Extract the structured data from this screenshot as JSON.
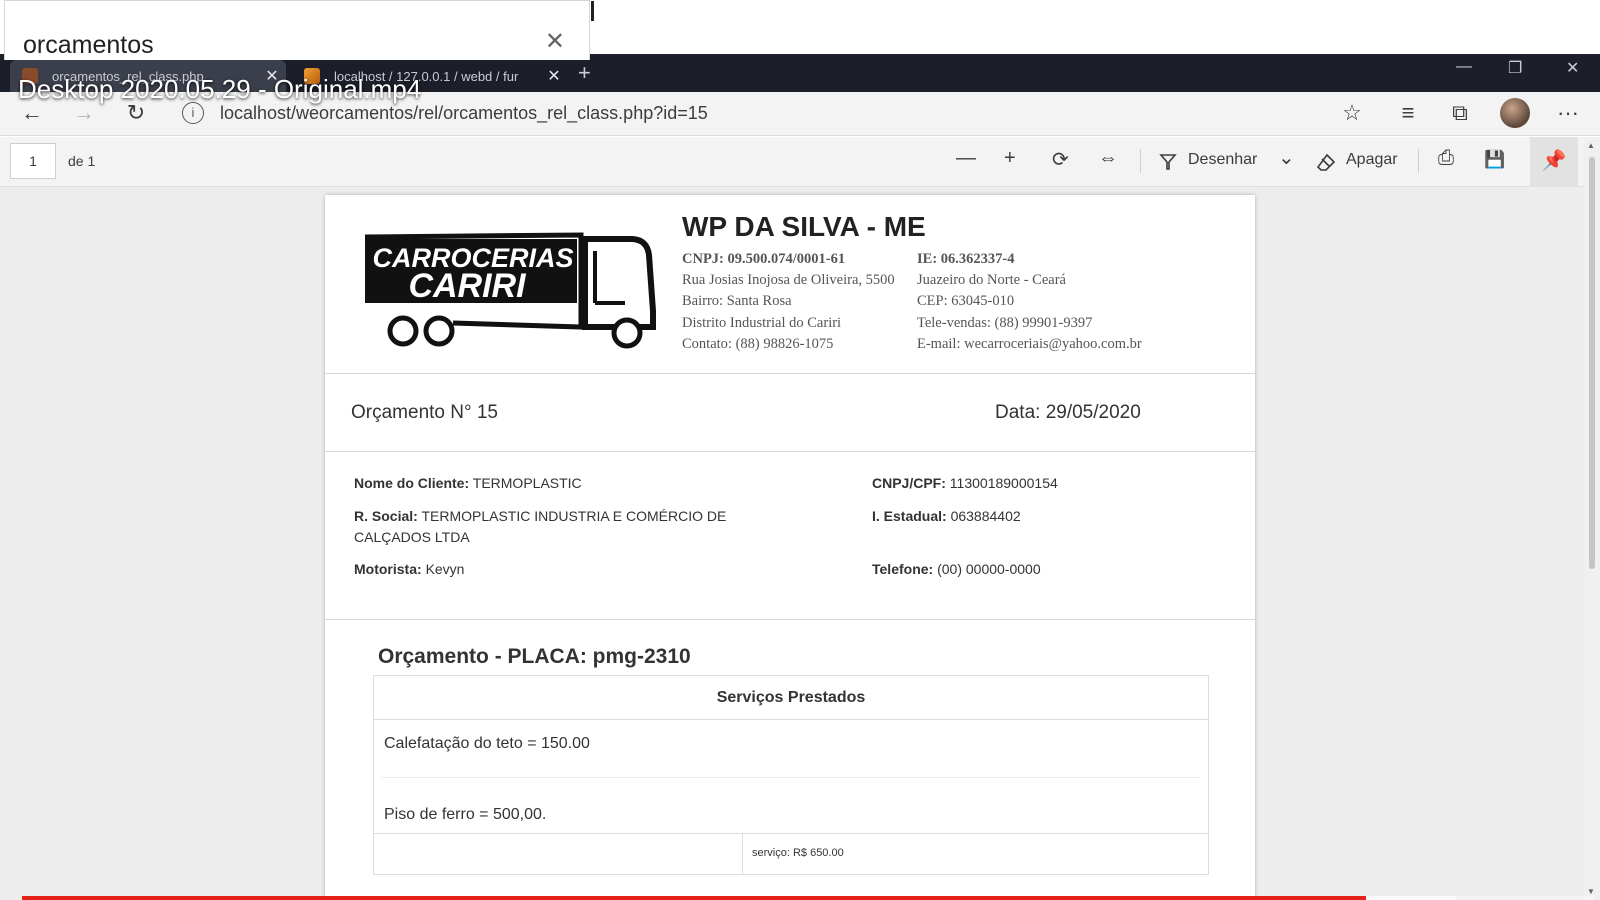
{
  "search_card": {
    "query": "orcamentos",
    "close": "✕"
  },
  "video_title": "Desktop 2020.05.29 - Original.mp4",
  "tabs": [
    {
      "label": "orcamentos_rel_class.php",
      "close": "✕"
    },
    {
      "label": "localhost / 127.0.0.1 / webd / fur",
      "close": "✕"
    }
  ],
  "new_tab": "+",
  "window_controls": {
    "minimize": "—",
    "restore": "❐",
    "close": "✕"
  },
  "nav": {
    "back": "←",
    "forward": "→",
    "reload": "↻",
    "info": "i",
    "url": "localhost/weorcamentos/rel/orcamentos_rel_class.php?id=15",
    "favorite": "☆",
    "favorites": "≡",
    "collections": "⧉",
    "more": "···"
  },
  "pdf_toolbar": {
    "page": "1",
    "page_of": "de 1",
    "zoom_out": "—",
    "zoom_in": "+",
    "rotate": "⟳",
    "fit": "⇔",
    "draw_label": "Desenhar",
    "draw_menu": "⌄",
    "erase_label": "Apagar",
    "print": "⎙",
    "save": "💾",
    "pin": "📌"
  },
  "doc": {
    "logo_line1": "CARROCERIAS",
    "logo_line2": "CARIRI",
    "company": "WP DA SILVA - ME",
    "cnpj_label": "CNPJ: 09.500.074/0001-61",
    "ie_label": "IE: 06.362337-4",
    "addr1": "Rua Josias Inojosa de Oliveira, 5500",
    "city": "Juazeiro do Norte - Ceará",
    "bairro": "Bairro: Santa Rosa",
    "cep": "CEP: 63045-010",
    "distrito": "Distrito Industrial do Cariri",
    "televendas": "Tele-vendas: (88) 99901-9397",
    "contato": "Contato: (88) 98826-1075",
    "email": "E-mail: wecarroceriais@yahoo.com.br",
    "orcamento_num": "Orçamento N° 15",
    "data": "Data: 29/05/2020",
    "cliente_label": "Nome do Cliente:",
    "cliente": "TERMOPLASTIC",
    "cnpjcpf_label": "CNPJ/CPF:",
    "cnpjcpf": "11300189000154",
    "rsocial_label": "R. Social:",
    "rsocial": "TERMOPLASTIC INDUSTRIA E COMÉRCIO DE CALÇADOS LTDA",
    "iestadual_label": "I. Estadual:",
    "iestadual": "063884402",
    "motorista_label": "Motorista:",
    "motorista": "Kevyn",
    "telefone_label": "Telefone:",
    "telefone": "(00) 00000-0000",
    "placa_title": "Orçamento - PLACA: pmg-2310",
    "servicos_header": "Serviços Prestados",
    "servicos": [
      "Calefatação do teto = 150.00",
      "Piso de ferro = 500,00."
    ],
    "servico_total": "serviço: R$ 650.00"
  },
  "video_progress": {
    "played_fraction": 0.855
  },
  "colors": {
    "tabstrip": "#1c1f2a",
    "progress": "#e62117"
  }
}
